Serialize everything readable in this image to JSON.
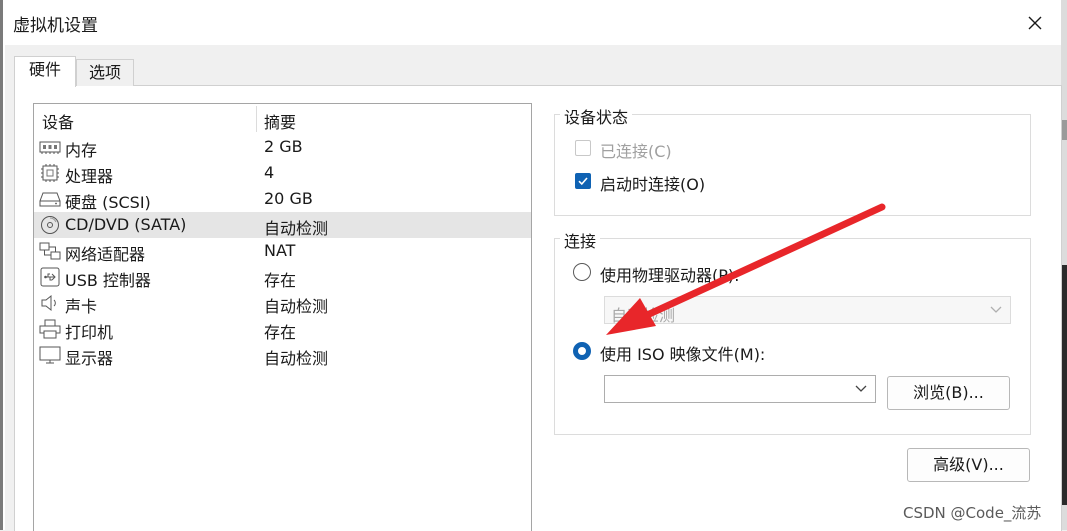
{
  "window": {
    "title": "虚拟机设置"
  },
  "tabs": [
    {
      "label": "硬件",
      "active": true
    },
    {
      "label": "选项",
      "active": false
    }
  ],
  "device_list": {
    "headers": {
      "device": "设备",
      "summary": "摘要"
    },
    "rows": [
      {
        "name": "内存",
        "summary": "2 GB",
        "icon": "memory-icon",
        "selected": false
      },
      {
        "name": "处理器",
        "summary": "4",
        "icon": "processor-icon",
        "selected": false
      },
      {
        "name": "硬盘 (SCSI)",
        "summary": "20 GB",
        "icon": "hard-disk-icon",
        "selected": false
      },
      {
        "name": "CD/DVD (SATA)",
        "summary": "自动检测",
        "icon": "cd-dvd-icon",
        "selected": true
      },
      {
        "name": "网络适配器",
        "summary": "NAT",
        "icon": "network-adapter-icon",
        "selected": false
      },
      {
        "name": "USB 控制器",
        "summary": "存在",
        "icon": "usb-icon",
        "selected": false
      },
      {
        "name": "声卡",
        "summary": "自动检测",
        "icon": "speaker-icon",
        "selected": false
      },
      {
        "name": "打印机",
        "summary": "存在",
        "icon": "printer-icon",
        "selected": false
      },
      {
        "name": "显示器",
        "summary": "自动检测",
        "icon": "monitor-icon",
        "selected": false
      }
    ]
  },
  "device_status": {
    "label": "设备状态",
    "connected": {
      "label": "已连接(C)",
      "checked": false,
      "disabled": true
    },
    "connect_at_power_on": {
      "label": "启动时连接(O)",
      "checked": true
    }
  },
  "connection": {
    "label": "连接",
    "physical_drive": {
      "label": "使用物理驱动器(P):",
      "selected": false,
      "value": "自动检测"
    },
    "iso_image": {
      "label": "使用 ISO 映像文件(M):",
      "selected": true,
      "value": ""
    },
    "browse_label": "浏览(B)..."
  },
  "advanced_label": "高级(V)...",
  "watermark": "CSDN @Code_流苏",
  "colors": {
    "accent": "#0f62b3",
    "annotation_arrow": "#e8262a"
  }
}
